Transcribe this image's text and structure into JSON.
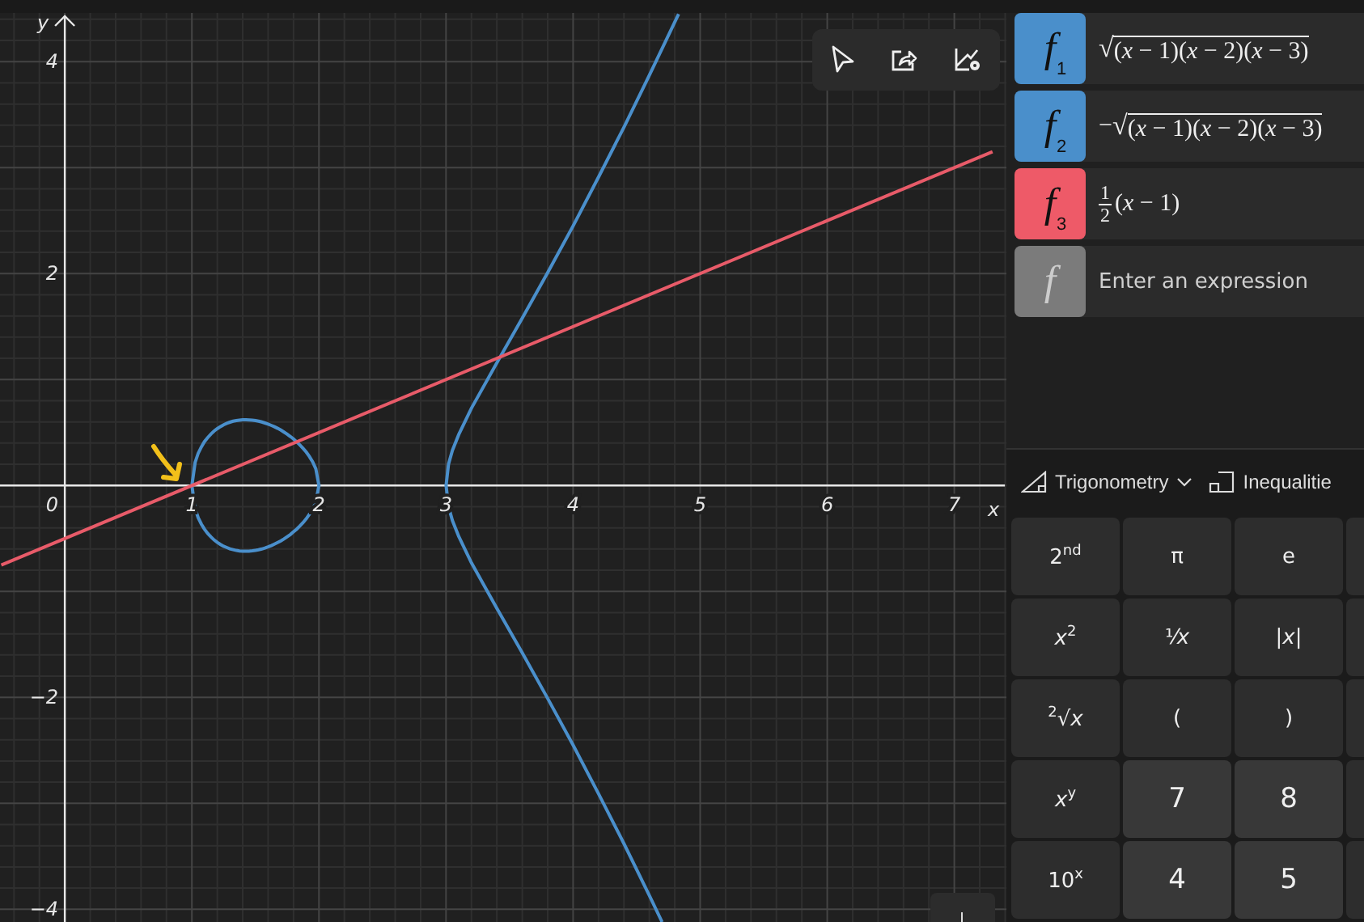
{
  "graph": {
    "toolbar": [
      {
        "kind": "select"
      },
      {
        "kind": "share"
      },
      {
        "kind": "settings"
      }
    ],
    "chart_data": {
      "type": "line",
      "grid": true,
      "xlabel": "x",
      "ylabel": "y",
      "xlim": [
        -0.51,
        7.41
      ],
      "ylim": [
        -4.12,
        4.46
      ],
      "xticks": [
        1,
        2,
        3,
        4,
        5,
        6,
        7
      ],
      "yticks": [
        -4,
        -2,
        2,
        4
      ],
      "x": [
        -0.5,
        7.3
      ],
      "series": [
        {
          "color": "#4a8fcb",
          "x": [
            4.83,
            4.6,
            4.4,
            4.2,
            4,
            3.8,
            3.6,
            3.4,
            3.2,
            3.1,
            3.05,
            3.02,
            3,
            3.02,
            3.05,
            3.1,
            3.2,
            3.4,
            3.6,
            3.8,
            4,
            4.2,
            4.4,
            4.6,
            4.7
          ],
          "values": [
            4.45,
            3.87,
            3.38,
            2.91,
            2.45,
            2.01,
            1.58,
            1.16,
            0.73,
            0.48,
            0.33,
            0.2,
            0,
            -0.2,
            -0.33,
            -0.48,
            -0.73,
            -1.16,
            -1.58,
            -2.01,
            -2.45,
            -2.91,
            -3.38,
            -3.87,
            -4.12
          ]
        },
        {
          "color": "#e85b69",
          "values": [
            -0.75,
            3.15
          ]
        }
      ]
    },
    "origin_label": "0"
  },
  "functions": [
    {
      "kind": "sqrt",
      "color": "#4a8fcb",
      "symbol": "f",
      "index": "1",
      "radical": "√",
      "radicand": "(*x* − 1)(*x* − 2)(*x* − 3)"
    },
    {
      "kind": "sqrt",
      "color": "#4a8fcb",
      "symbol": "f",
      "index": "2",
      "prefix": "−",
      "radical": "√",
      "radicand": "(*x* − 1)(*x* − 2)(*x* − 3)"
    },
    {
      "kind": "fraction",
      "color": "#ee5a68",
      "symbol": "f",
      "index": "3",
      "numerator": "1",
      "denominator": "2",
      "rest": "(*x* − 1)"
    },
    {
      "kind": "empty",
      "color": "#7b7b7b",
      "symbol": "f",
      "placeholder": "Enter an expression"
    }
  ],
  "keypad_toolbar": [
    {
      "kind": "trig",
      "label": "Trigonometry",
      "dropdown": true
    },
    {
      "kind": "ineq",
      "label": "Inequalitie",
      "dropdown": false
    }
  ],
  "keypad": [
    [
      {
        "kind": "function",
        "label": "2$^{nd}$"
      },
      {
        "kind": "function",
        "label": "π"
      },
      {
        "kind": "function",
        "label": "e"
      }
    ],
    [
      {
        "kind": "function",
        "label": "*x*$^{2}$"
      },
      {
        "kind": "function",
        "label": "¹⁄*x*"
      },
      {
        "kind": "function",
        "label": "|*x*|"
      }
    ],
    [
      {
        "kind": "function",
        "label": "$^{2}$√*x*"
      },
      {
        "kind": "function",
        "label": "("
      },
      {
        "kind": "function",
        "label": ")"
      }
    ],
    [
      {
        "kind": "function",
        "label": "*x*$^{y}$"
      },
      {
        "kind": "digit",
        "label": "7"
      },
      {
        "kind": "digit",
        "label": "8"
      }
    ],
    [
      {
        "kind": "function",
        "label": "10$^{x}$"
      },
      {
        "kind": "digit",
        "label": "4"
      },
      {
        "kind": "digit",
        "label": "5"
      }
    ]
  ]
}
